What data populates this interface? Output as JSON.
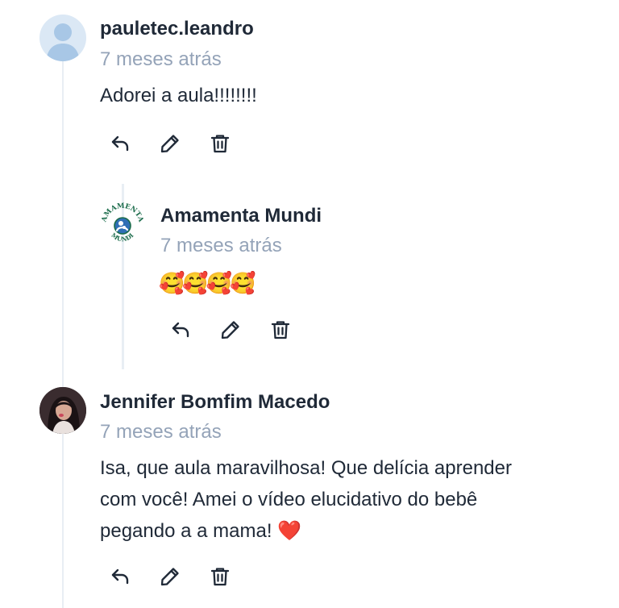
{
  "comments": [
    {
      "author": "pauletec.leandro",
      "time": "7 meses atrás",
      "text": "Adorei a aula!!!!!!!!",
      "reply": {
        "author": "Amamenta Mundi",
        "time": "7 meses atrás",
        "text": "🥰🥰🥰🥰",
        "logo_text_top": "AMAMENTA",
        "logo_text_bottom": "MUNDI"
      }
    },
    {
      "author": "Jennifer Bomfim Macedo",
      "time": "7 meses atrás",
      "text": "Isa, que aula maravilhosa! Que delícia aprender\ncom você! Amei o vídeo elucidativo do bebê\npegando a a mama! ❤️"
    }
  ],
  "icons": {
    "reply": "reply-arrow-icon",
    "edit": "pencil-icon",
    "delete": "trash-icon"
  },
  "colors": {
    "text": "#1f2937",
    "muted": "#94a3b8",
    "thread_line": "#e8eef4",
    "icon": "#1f2937",
    "logo_green": "#1a6b4a",
    "logo_blue": "#2f6fb5"
  }
}
